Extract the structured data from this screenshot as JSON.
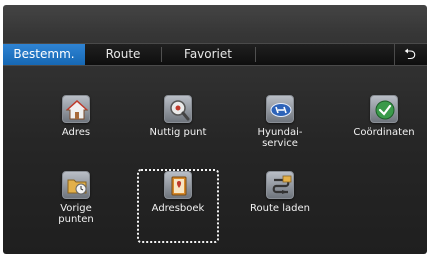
{
  "tabs": [
    {
      "label": "Bestemm.",
      "active": true
    },
    {
      "label": "Route",
      "active": false
    },
    {
      "label": "Favoriet",
      "active": false
    }
  ],
  "back_icon": "return-arrow-icon",
  "menu": [
    {
      "label": "Adres",
      "icon": "house-icon"
    },
    {
      "label": "Nuttig punt",
      "icon": "magnifier-poi-icon"
    },
    {
      "label": "Hyundai-\nservice",
      "icon": "hyundai-logo-icon"
    },
    {
      "label": "Coördinaten",
      "icon": "globe-check-icon"
    },
    {
      "label": "Vorige\npunten",
      "icon": "folder-clock-icon"
    },
    {
      "label": "Adresboek",
      "icon": "address-book-icon",
      "focused": true
    },
    {
      "label": "Route laden",
      "icon": "route-load-icon"
    }
  ],
  "colors": {
    "active_tab": "#1e74c4",
    "background": "#2a2a2a",
    "text": "#f2f2f2"
  }
}
